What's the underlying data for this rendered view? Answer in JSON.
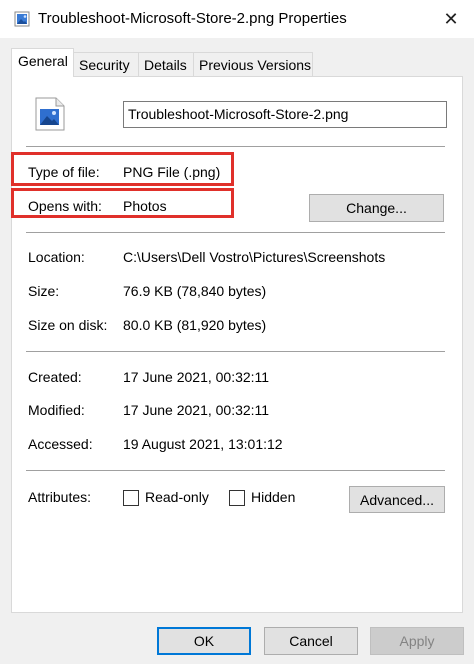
{
  "window": {
    "title": "Troubleshoot-Microsoft-Store-2.png Properties",
    "close_glyph": "✕"
  },
  "tabs": [
    {
      "label": "General",
      "active": true
    },
    {
      "label": "Security",
      "active": false
    },
    {
      "label": "Details",
      "active": false
    },
    {
      "label": "Previous Versions",
      "active": false
    }
  ],
  "general": {
    "filename": "Troubleshoot-Microsoft-Store-2.png",
    "type_of_file_label": "Type of file:",
    "type_of_file_value": "PNG File (.png)",
    "opens_with_label": "Opens with:",
    "opens_with_value": "Photos",
    "change_button": "Change...",
    "location_label": "Location:",
    "location_value": "C:\\Users\\Dell Vostro\\Pictures\\Screenshots",
    "size_label": "Size:",
    "size_value": "76.9 KB (78,840 bytes)",
    "size_on_disk_label": "Size on disk:",
    "size_on_disk_value": "80.0 KB (81,920 bytes)",
    "created_label": "Created:",
    "created_value": "17 June 2021, 00:32:11",
    "modified_label": "Modified:",
    "modified_value": "17 June 2021, 00:32:11",
    "accessed_label": "Accessed:",
    "accessed_value": "19 August 2021, 13:01:12",
    "attributes_label": "Attributes:",
    "readonly_label": "Read-only",
    "hidden_label": "Hidden",
    "advanced_button": "Advanced..."
  },
  "footer": {
    "ok": "OK",
    "cancel": "Cancel",
    "apply": "Apply"
  },
  "colors": {
    "highlight_box": "#e0302a",
    "default_button_border": "#0078d7"
  },
  "icons": {
    "title": "image-file-icon",
    "file": "image-file-icon"
  }
}
